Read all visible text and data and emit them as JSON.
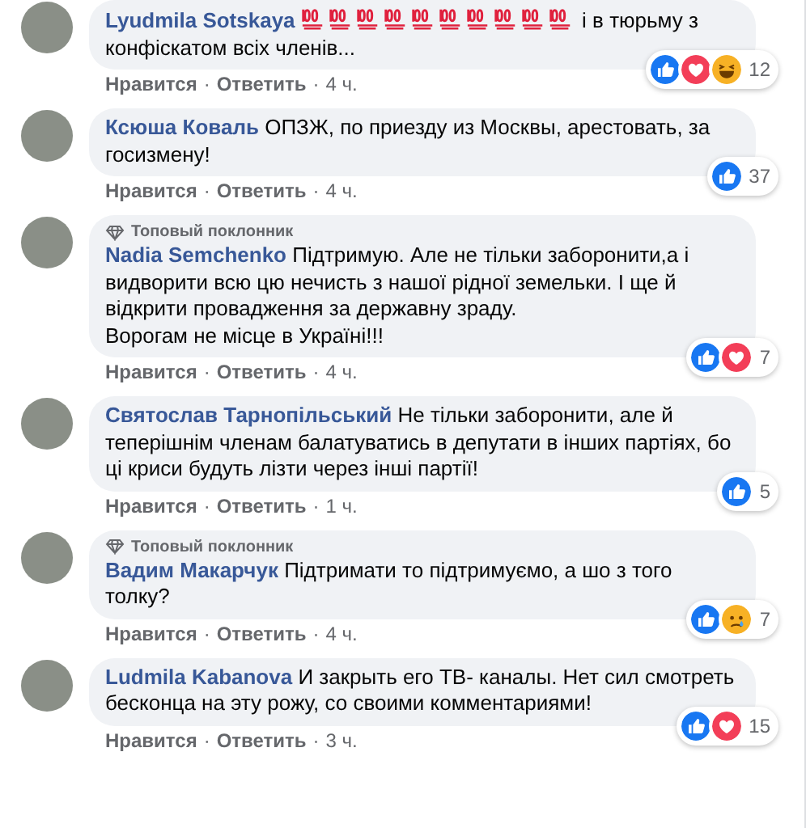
{
  "separator": "·",
  "comments": [
    {
      "author": "Lyudmila Sotskaya",
      "emojis": [
        {
          "kind": "hundred"
        },
        {
          "kind": "hundred"
        },
        {
          "kind": "hundred"
        },
        {
          "kind": "hundred"
        },
        {
          "kind": "hundred"
        },
        {
          "kind": "hundred"
        },
        {
          "kind": "hundred"
        },
        {
          "kind": "hundred"
        },
        {
          "kind": "hundred"
        },
        {
          "kind": "hundred"
        }
      ],
      "text": "і в тюрьму з конфіскатом всіх членів...",
      "reactions": [
        {
          "kind": "like"
        },
        {
          "kind": "love"
        },
        {
          "kind": "haha"
        }
      ],
      "count": "12",
      "actions": [
        "Нравится",
        "Ответить",
        "4 ч."
      ]
    },
    {
      "author": "Ксюша Коваль",
      "text": "ОПЗЖ, по приезду из Москвы, арестовать, за госизмену!",
      "reactions": [
        {
          "kind": "like"
        }
      ],
      "count": "37",
      "actions": [
        "Нравится",
        "Ответить",
        "4 ч."
      ]
    },
    {
      "author": "Nadia Semchenko",
      "badge": "Топовый поклонник",
      "text": "Підтримую. Але не тільки заборонити,а і видворити всю цю нечисть з нашої рідної земельки. І ще й відкрити провадження за державну зраду.\nВорогам не місце в Україні!!!",
      "reactions": [
        {
          "kind": "like"
        },
        {
          "kind": "love"
        }
      ],
      "count": "7",
      "actions": [
        "Нравится",
        "Ответить",
        "4 ч."
      ]
    },
    {
      "author": "Святослав Тарнопільський",
      "text": "Не тільки заборонити, але й теперішнім членам балатуватись в депутати в інших партіях, бо ці криси будуть лізти через інші партії!",
      "reactions": [
        {
          "kind": "like"
        }
      ],
      "count": "5",
      "actions": [
        "Нравится",
        "Ответить",
        "1 ч."
      ]
    },
    {
      "author": "Вадим Макарчук",
      "badge": "Топовый поклонник",
      "text": "Підтримати то підтримуємо, а шо з того толку?",
      "reactions": [
        {
          "kind": "like"
        },
        {
          "kind": "sad"
        }
      ],
      "count": "7",
      "actions": [
        "Нравится",
        "Ответить",
        "4 ч."
      ]
    },
    {
      "author": "Ludmila Kabanova",
      "text": "И закрыть его ТВ- каналы. Нет сил смотреть бесконца на эту рожу, со своими комментариями!",
      "reactions": [
        {
          "kind": "like"
        },
        {
          "kind": "love"
        }
      ],
      "count": "15",
      "actions": [
        "Нравится",
        "Ответить",
        "3 ч."
      ]
    }
  ]
}
